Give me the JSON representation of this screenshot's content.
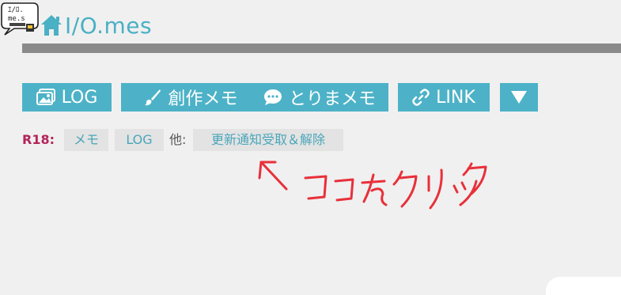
{
  "header": {
    "logo_text": "I/O.mes",
    "title": "I/O.mes"
  },
  "nav": {
    "items": [
      {
        "label": "LOG",
        "icon": "image-icon"
      },
      {
        "label": "創作メモ",
        "icon": "brush-icon"
      },
      {
        "label": "とりまメモ",
        "icon": "speech-bubble-icon"
      },
      {
        "label": "LINK",
        "icon": "link-icon"
      },
      {
        "label": "",
        "icon": "triangle-down-icon"
      }
    ]
  },
  "r18": {
    "label": "R18:",
    "tags": [
      "メモ",
      "LOG"
    ],
    "other_label": "他:",
    "notify_link": "更新通知受取＆解除"
  },
  "annotation": {
    "text": "ココをクリック",
    "color": "#e8303a"
  },
  "colors": {
    "accent": "#4db2c7",
    "r18": "#b3245a",
    "background": "#f0f0f0"
  }
}
